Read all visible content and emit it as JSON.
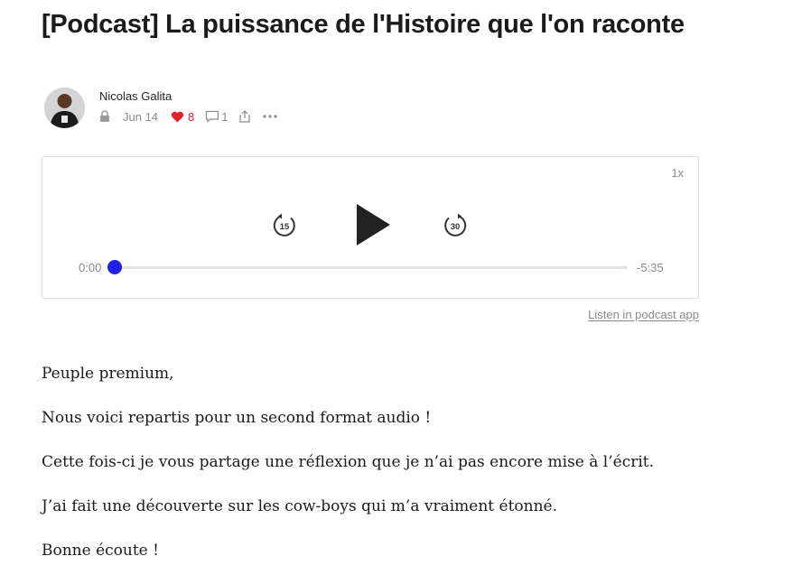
{
  "post": {
    "title": "[Podcast] La puissance de l'Histoire que l'on raconte",
    "author": "Nicolas Galita",
    "date": "Jun 14",
    "likes": "8",
    "comments": "1"
  },
  "icons": {
    "lock": "lock-icon",
    "like": "heart-icon",
    "comment": "comment-icon",
    "share": "share-icon",
    "more": "more-icon"
  },
  "colors": {
    "accent": "#1f1fe6",
    "like": "#e0202a"
  },
  "player": {
    "speed": "1x",
    "rewind_seconds": "15",
    "forward_seconds": "30",
    "current_time": "0:00",
    "remaining_time": "-5:35",
    "progress": 0
  },
  "listen_link": "Listen in podcast app",
  "body": [
    "Peuple premium,",
    "Nous voici repartis pour un second format audio !",
    "Cette fois-ci je vous partage une réflexion que je n’ai pas encore mise à l’écrit.",
    "J’ai fait une découverte sur les cow-boys qui m’a vraiment étonné.",
    "Bonne écoute !"
  ]
}
